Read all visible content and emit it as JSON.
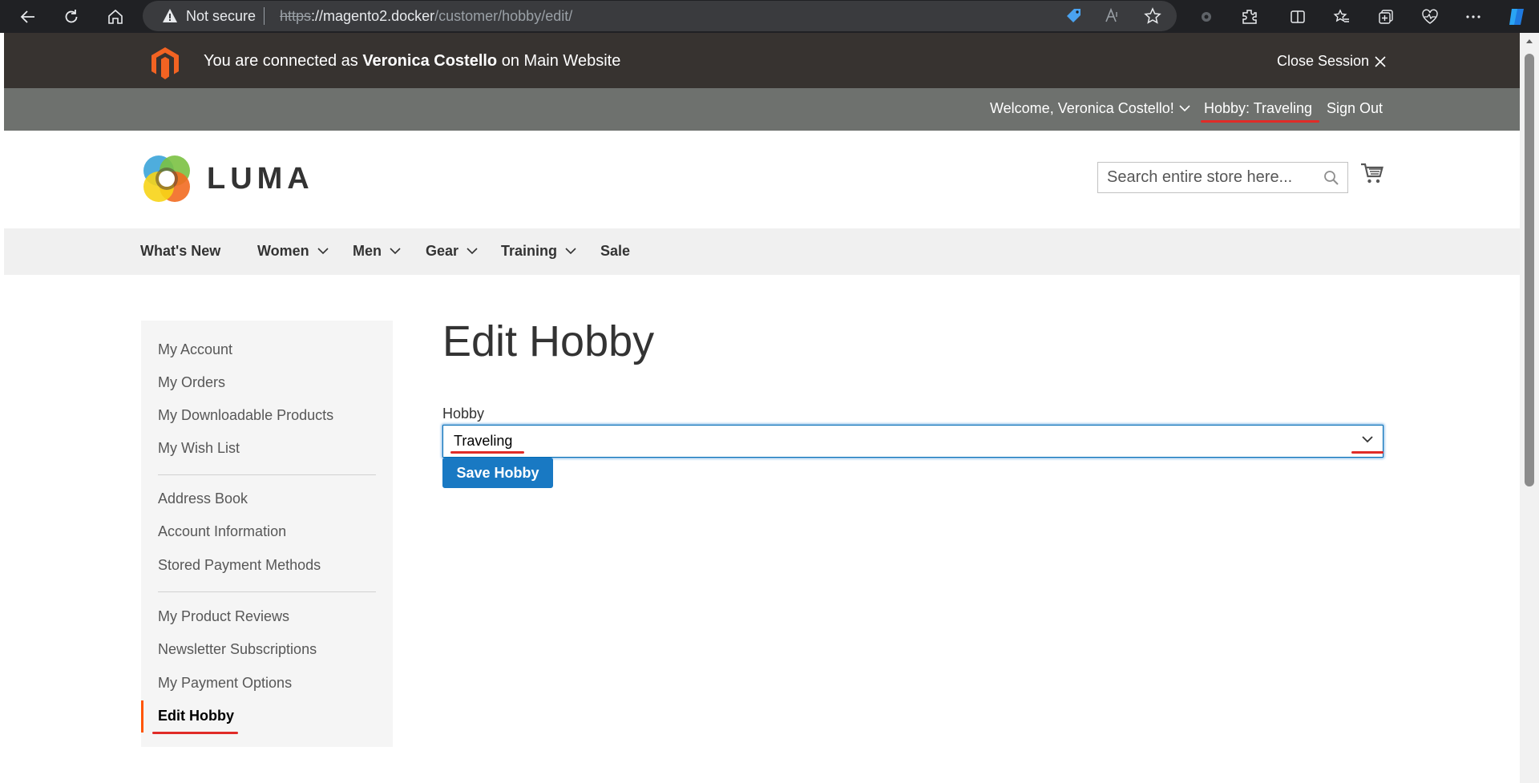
{
  "browser": {
    "security_status": "Not secure",
    "url_scheme": "https",
    "url_host": "://magento2.docker",
    "url_path": "/customer/hobby/edit/"
  },
  "session": {
    "prefix": "You are connected as",
    "customer_name": "Veronica Costello",
    "suffix": "on Main Website",
    "close_label": "Close Session"
  },
  "panel": {
    "welcome": "Welcome, Veronica Costello!",
    "hobby_link": "Hobby: Traveling",
    "sign_out": "Sign Out"
  },
  "header": {
    "logo_text": "LUMA",
    "search_placeholder": "Search entire store here..."
  },
  "nav": {
    "items": [
      {
        "label": "What's New"
      },
      {
        "label": "Women"
      },
      {
        "label": "Men"
      },
      {
        "label": "Gear"
      },
      {
        "label": "Training"
      },
      {
        "label": "Sale"
      }
    ]
  },
  "sidebar": {
    "group1": [
      "My Account",
      "My Orders",
      "My Downloadable Products",
      "My Wish List"
    ],
    "group2": [
      "Address Book",
      "Account Information",
      "Stored Payment Methods"
    ],
    "group3": [
      "My Product Reviews",
      "Newsletter Subscriptions",
      "My Payment Options",
      "Edit Hobby"
    ]
  },
  "main": {
    "title": "Edit Hobby",
    "field_label": "Hobby",
    "selected_value": "Traveling",
    "save_label": "Save Hobby"
  },
  "colors": {
    "session_bar": "#373330",
    "panel_header": "#6e716e",
    "primary_button": "#1979c3",
    "active_accent": "#ff5501",
    "annotation_underline": "#e02b27"
  }
}
